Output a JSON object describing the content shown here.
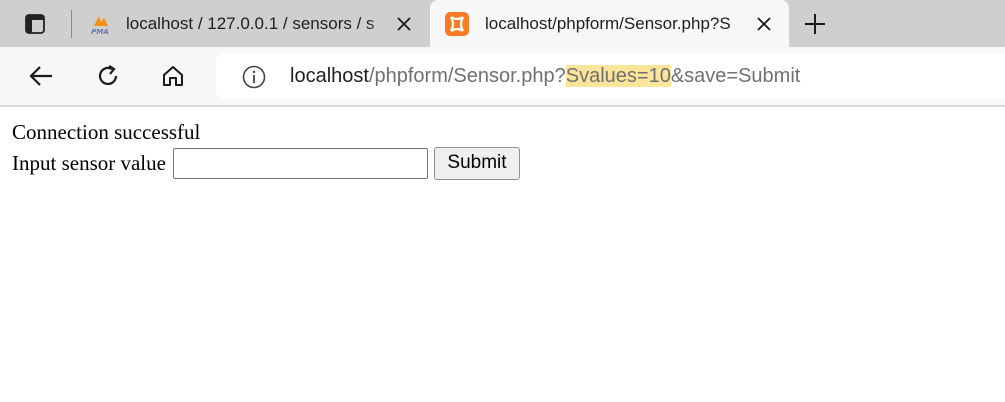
{
  "browser": {
    "tabs": [
      {
        "title": "localhost / 127.0.0.1 / sensors / s",
        "icon": "phpmyadmin-icon",
        "icon_text": "PMA"
      },
      {
        "title": "localhost/phpform/Sensor.php?S",
        "icon": "xampp-icon",
        "active": true
      }
    ],
    "address": {
      "host": "localhost",
      "path": "/phpform/Sensor.php?",
      "highlight": "Svalues=10",
      "rest": "&save=Submit"
    }
  },
  "page": {
    "status_text": "Connection successful",
    "sensor_label": "Input sensor value",
    "sensor_value": "",
    "submit_label": "Submit"
  },
  "colors": {
    "tabstrip_bg": "#cfcfcf",
    "toolbar_bg": "#f7f7f7",
    "url_highlight": "#fbe59a",
    "xampp_orange": "#fb7a24"
  }
}
